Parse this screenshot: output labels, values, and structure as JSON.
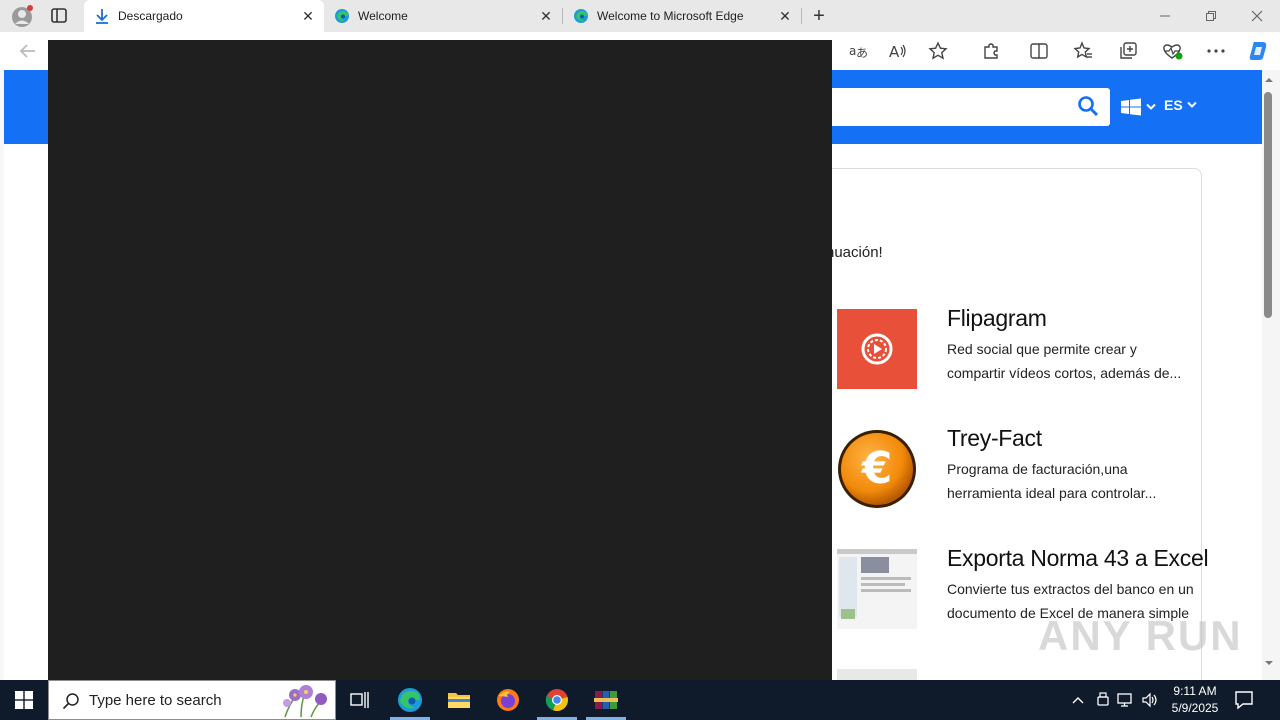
{
  "browser": {
    "tabs": [
      {
        "title": "Descargado",
        "icon": "download-icon",
        "active": true
      },
      {
        "title": "Welcome",
        "icon": "edge-icon",
        "active": false
      },
      {
        "title": "Welcome to Microsoft Edge",
        "icon": "edge-icon",
        "active": false
      }
    ],
    "close_glyph": "✕",
    "new_tab_glyph": "+"
  },
  "page": {
    "language": "ES",
    "intro_text": "nuación!",
    "apps": [
      {
        "name": "Flipagram",
        "desc": "Red social que permite crear y compartir vídeos cortos, además de...",
        "thumb": "flipagram-logo"
      },
      {
        "name": "Trey-Fact",
        "desc": "Programa de facturación,una herramienta ideal para controlar...",
        "thumb": "euro-coin-logo"
      },
      {
        "name": "Exporta Norma 43 a Excel",
        "desc": "Convierte tus extractos del banco en un documento de Excel de manera simple",
        "thumb": "spreadsheet-screenshot"
      }
    ],
    "watermark": "ANY RUN",
    "colors": {
      "brand_blue": "#1470f5",
      "flipagram_red": "#e8503a",
      "euro_orange": "#f28a0a"
    }
  },
  "taskbar": {
    "search_placeholder": "Type here to search",
    "time": "9:11 AM",
    "date": "5/9/2025"
  }
}
